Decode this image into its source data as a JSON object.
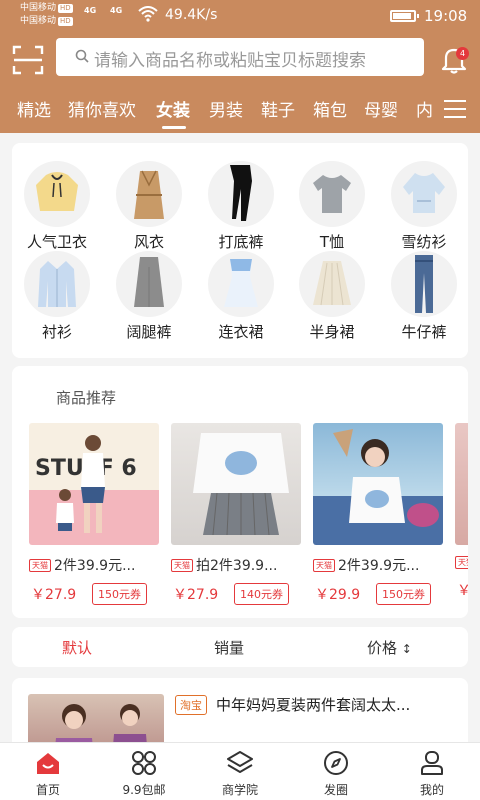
{
  "status_bar": {
    "carrier1": "中国移动",
    "carrier2": "中国移动",
    "hd_tag": "HD",
    "signal1": "4G",
    "signal2": "4G",
    "speed": "49.4K/s",
    "time": "19:08"
  },
  "header": {
    "search_placeholder": "请输入商品名称或粘贴宝贝标题搜索",
    "notification_count": "4"
  },
  "tabs": [
    "精选",
    "猜你喜欢",
    "女装",
    "男装",
    "鞋子",
    "箱包",
    "母婴",
    "内"
  ],
  "active_tab_index": 2,
  "categories": [
    {
      "label": "人气卫衣",
      "icon": "hoodie-icon"
    },
    {
      "label": "风衣",
      "icon": "trench-coat-icon"
    },
    {
      "label": "打底裤",
      "icon": "leggings-icon"
    },
    {
      "label": "T恤",
      "icon": "tshirt-icon"
    },
    {
      "label": "雪纺衫",
      "icon": "chiffon-blouse-icon"
    },
    {
      "label": "衬衫",
      "icon": "shirt-icon"
    },
    {
      "label": "阔腿裤",
      "icon": "wide-pants-icon"
    },
    {
      "label": "连衣裙",
      "icon": "dress-icon"
    },
    {
      "label": "半身裙",
      "icon": "skirt-icon"
    },
    {
      "label": "牛仔裤",
      "icon": "jeans-icon"
    }
  ],
  "recommend": {
    "title": "商品推荐",
    "tmall_tag": "天猫",
    "items": [
      {
        "name": "2件39.9元...",
        "price": "￥27.9",
        "coupon": "150元券",
        "photo_text": "STUFF 6"
      },
      {
        "name": "拍2件39.9...",
        "price": "￥27.9",
        "coupon": "140元券"
      },
      {
        "name": "2件39.9元...",
        "price": "￥29.9",
        "coupon": "150元券"
      },
      {
        "name": "",
        "price": "￥",
        "coupon": ""
      }
    ]
  },
  "sort": {
    "default": "默认",
    "sales": "销量",
    "price": "价格",
    "price_icon": "↕"
  },
  "list_item": {
    "source_tag": "淘宝",
    "title": "中年妈妈夏装两件套阔太太..."
  },
  "bottom_nav": [
    {
      "label": "首页",
      "icon": "home-icon"
    },
    {
      "label": "9.9包邮",
      "icon": "grid-icon"
    },
    {
      "label": "商学院",
      "icon": "layers-icon"
    },
    {
      "label": "发圈",
      "icon": "compass-icon"
    },
    {
      "label": "我的",
      "icon": "profile-icon"
    }
  ],
  "colors": {
    "brand": "#c98a5e",
    "accent_red": "#e4393c"
  }
}
